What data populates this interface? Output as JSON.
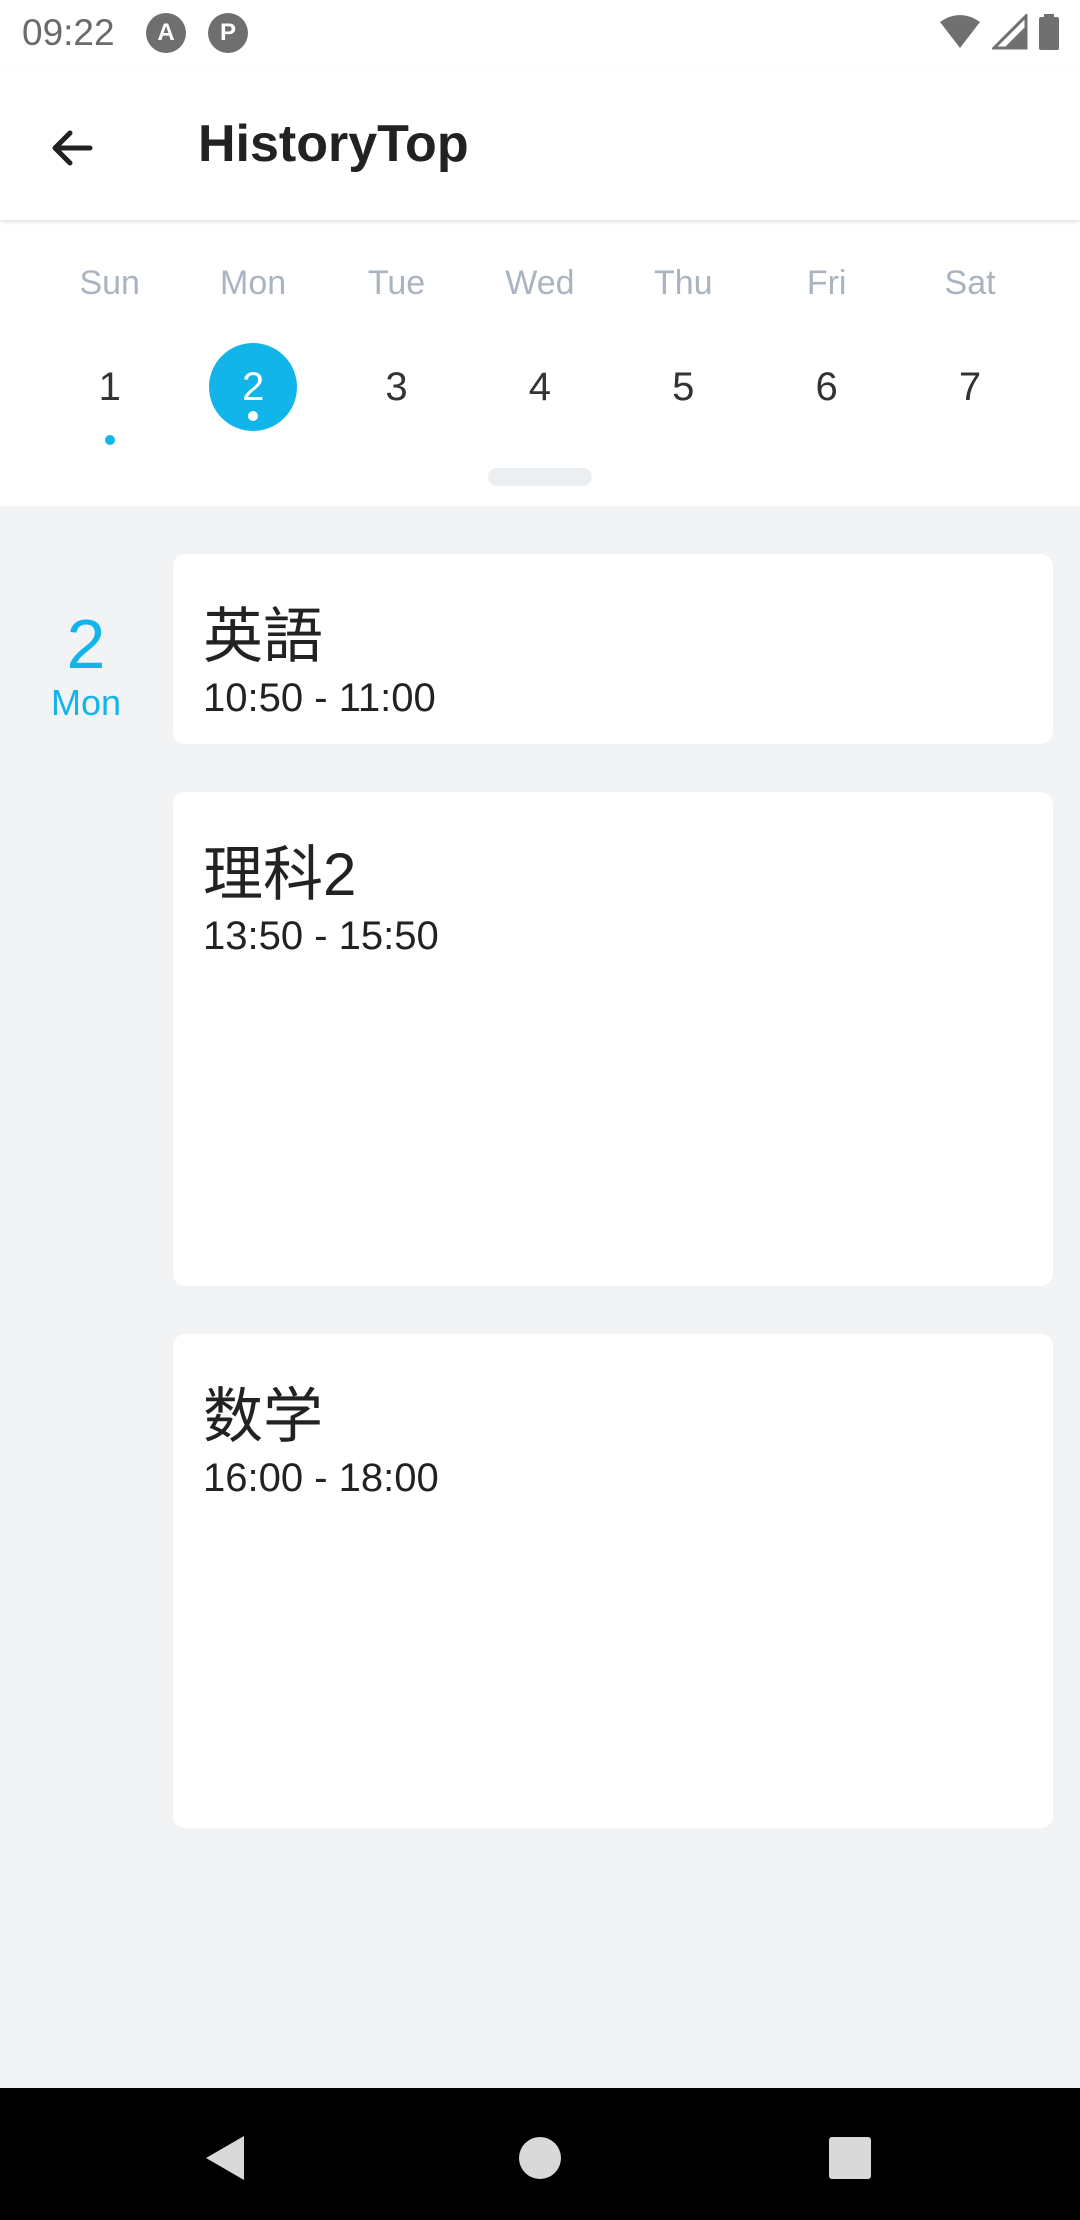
{
  "status_bar": {
    "time": "09:22",
    "app_icons": [
      "A",
      "P"
    ]
  },
  "app_bar": {
    "title": "HistoryTop",
    "back_icon": "arrow-left-icon"
  },
  "week": {
    "days": [
      {
        "dow": "Sun",
        "date": "1",
        "has_event": true,
        "selected": false
      },
      {
        "dow": "Mon",
        "date": "2",
        "has_event": true,
        "selected": true
      },
      {
        "dow": "Tue",
        "date": "3",
        "has_event": false,
        "selected": false
      },
      {
        "dow": "Wed",
        "date": "4",
        "has_event": false,
        "selected": false
      },
      {
        "dow": "Thu",
        "date": "5",
        "has_event": false,
        "selected": false
      },
      {
        "dow": "Fri",
        "date": "6",
        "has_event": false,
        "selected": false
      },
      {
        "dow": "Sat",
        "date": "7",
        "has_event": false,
        "selected": false
      }
    ]
  },
  "selected_day": {
    "num": "2",
    "name": "Mon"
  },
  "events": [
    {
      "title": "英語",
      "time": "10:50 - 11:00"
    },
    {
      "title": "理科2",
      "time": "13:50 - 15:50"
    },
    {
      "title": "数学",
      "time": "16:00 - 18:00"
    }
  ],
  "colors": {
    "accent": "#12b5ea",
    "background": "#f1f3f5",
    "card": "#ffffff"
  }
}
